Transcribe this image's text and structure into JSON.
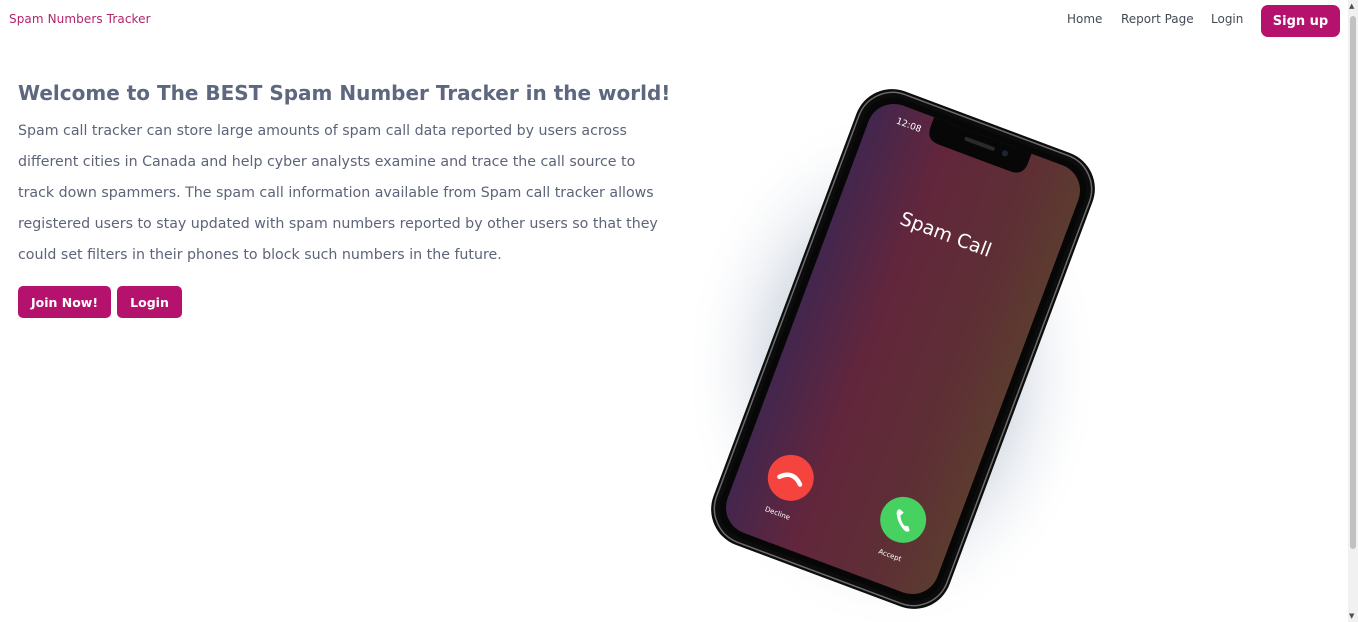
{
  "nav": {
    "brand": "Spam Numbers Tracker",
    "links": [
      "Home",
      "Report Page",
      "Login"
    ],
    "signup": "Sign up"
  },
  "hero": {
    "title": "Welcome to The BEST Spam Number Tracker in the world!",
    "description": "Spam call tracker can store large amounts of spam call data reported by users across different cities in Canada and help cyber analysts examine and trace the call source to track down spammers. The spam call information available from Spam call tracker allows registered users to stay updated with spam numbers reported by other users so that they could set filters in their phones to block such numbers in the future.",
    "join_button": "Join Now!",
    "login_button": "Login"
  },
  "phone": {
    "time": "12:08",
    "caller": "Spam Call",
    "decline_label": "Decline",
    "accept_label": "Accept",
    "decline_icon": "phone-hangup-icon",
    "accept_icon": "phone-icon"
  },
  "colors": {
    "brand": "#b5126d",
    "decline": "#f4443d",
    "accept": "#46d160"
  }
}
